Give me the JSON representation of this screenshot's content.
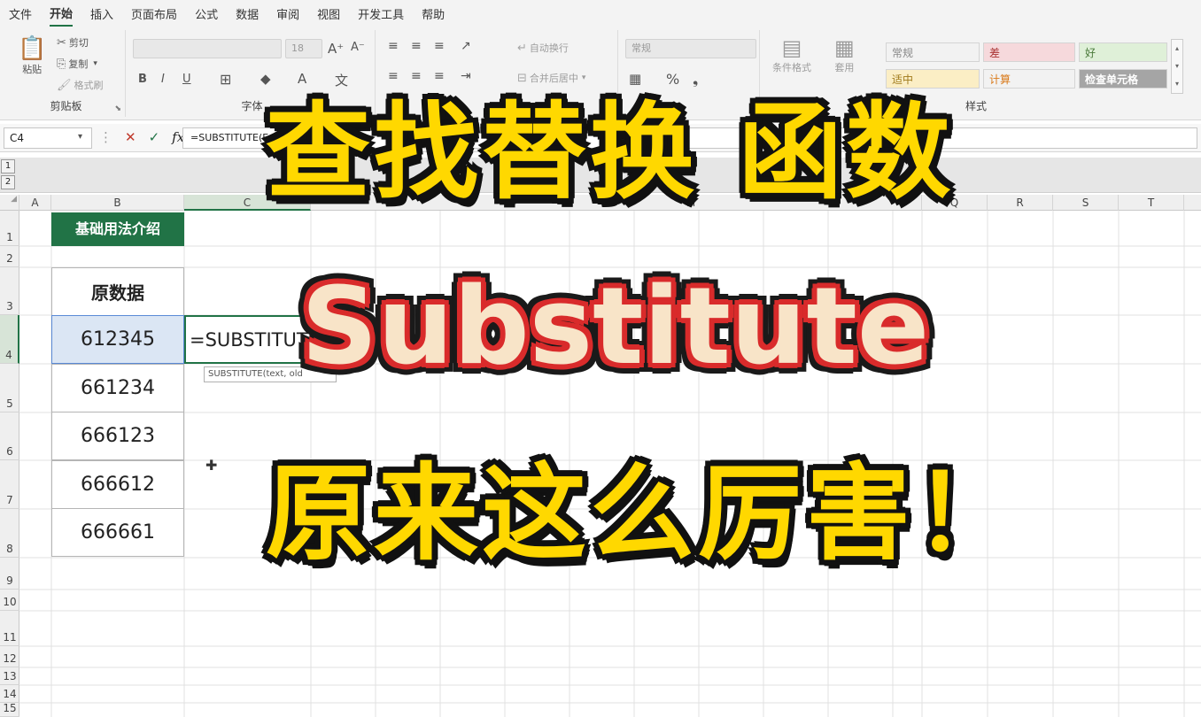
{
  "menu": {
    "items": [
      "文件",
      "开始",
      "插入",
      "页面布局",
      "公式",
      "数据",
      "审阅",
      "视图",
      "开发工具",
      "帮助"
    ],
    "active_index": 1
  },
  "ribbon": {
    "clipboard": {
      "paste": "粘贴",
      "cut": "剪切",
      "copy": "复制",
      "format_painter": "格式刷",
      "label": "剪贴板"
    },
    "font": {
      "size": "18",
      "label": "字体"
    },
    "alignment": {
      "wrap": "自动换行",
      "merge": "合并后居中"
    },
    "number": {
      "format": "常规"
    },
    "styles": {
      "conditional": "条件格式",
      "table": "套用",
      "label": "样式",
      "cells": [
        "常规",
        "差",
        "好",
        "适中",
        "计算",
        "检查单元格"
      ]
    }
  },
  "formula_bar": {
    "name_box": "C4",
    "formula": "=SUBSTITUTE(E"
  },
  "outline": {
    "levels": [
      "1",
      "2"
    ]
  },
  "columns": [
    "A",
    "B",
    "C",
    "M",
    "Q",
    "R",
    "S",
    "T"
  ],
  "rows": [
    "1",
    "2",
    "3",
    "4",
    "5",
    "6",
    "7",
    "8",
    "9",
    "10",
    "11",
    "12",
    "13",
    "14",
    "15"
  ],
  "sheet": {
    "title": "基础用法介绍",
    "header": "原数据",
    "values": [
      "612345",
      "661234",
      "666123",
      "666612",
      "666661"
    ],
    "editing": "=SUBSTITUTE",
    "tooltip": "SUBSTITUTE(text, old"
  },
  "overlay": {
    "line1": "查找替换 函数",
    "line2": "Substitute",
    "line3": "原来这么厉害！"
  },
  "colors": {
    "accent": "#217346",
    "overlay_yellow": "#ffd800",
    "overlay_red": "#d92b2b",
    "selection": "#dbe6f4"
  }
}
